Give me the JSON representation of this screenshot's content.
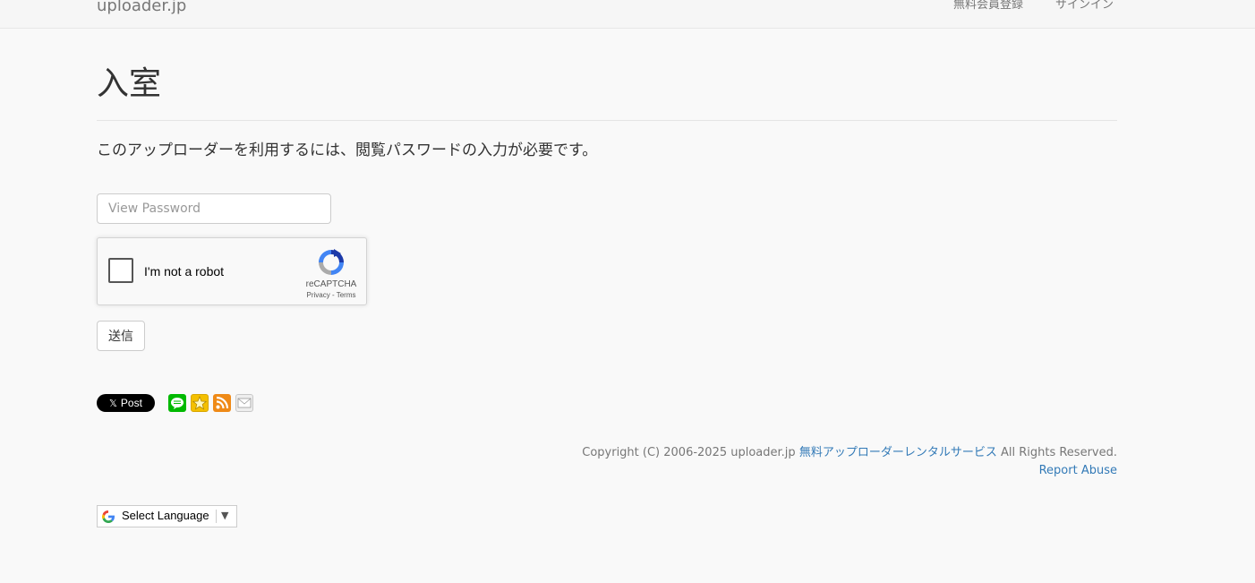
{
  "header": {
    "brand": "uploader.jp",
    "nav": {
      "register": "無料会員登録",
      "signin": "サインイン"
    }
  },
  "main": {
    "title": "入室",
    "intro": "このアップローダーを利用するには、閲覧パスワードの入力が必要です。",
    "password_placeholder": "View Password",
    "password_value": "",
    "submit_label": "送信"
  },
  "recaptcha": {
    "label": "I'm not a robot",
    "brand": "reCAPTCHA",
    "privacy": "Privacy",
    "separator": " - ",
    "terms": "Terms",
    "checked": false
  },
  "share": {
    "x_mark": "𝕏",
    "x_label": "Post",
    "icons": [
      "line-icon",
      "star-icon",
      "rss-icon",
      "mail-icon"
    ]
  },
  "footer": {
    "copyright_prefix": "Copyright (C) 2006-2025 uploader.jp ",
    "copyright_link": "無料アップローダーレンタルサービス",
    "copyright_suffix": " All Rights Reserved.",
    "report_abuse": "Report Abuse"
  },
  "language": {
    "label": "Select Language",
    "arrow": "▼"
  },
  "colors": {
    "link": "#337ab7",
    "muted": "#777777",
    "line_green": "#00b900",
    "rss_orange": "#ef8a17",
    "star_yellow": "#f4c000"
  }
}
